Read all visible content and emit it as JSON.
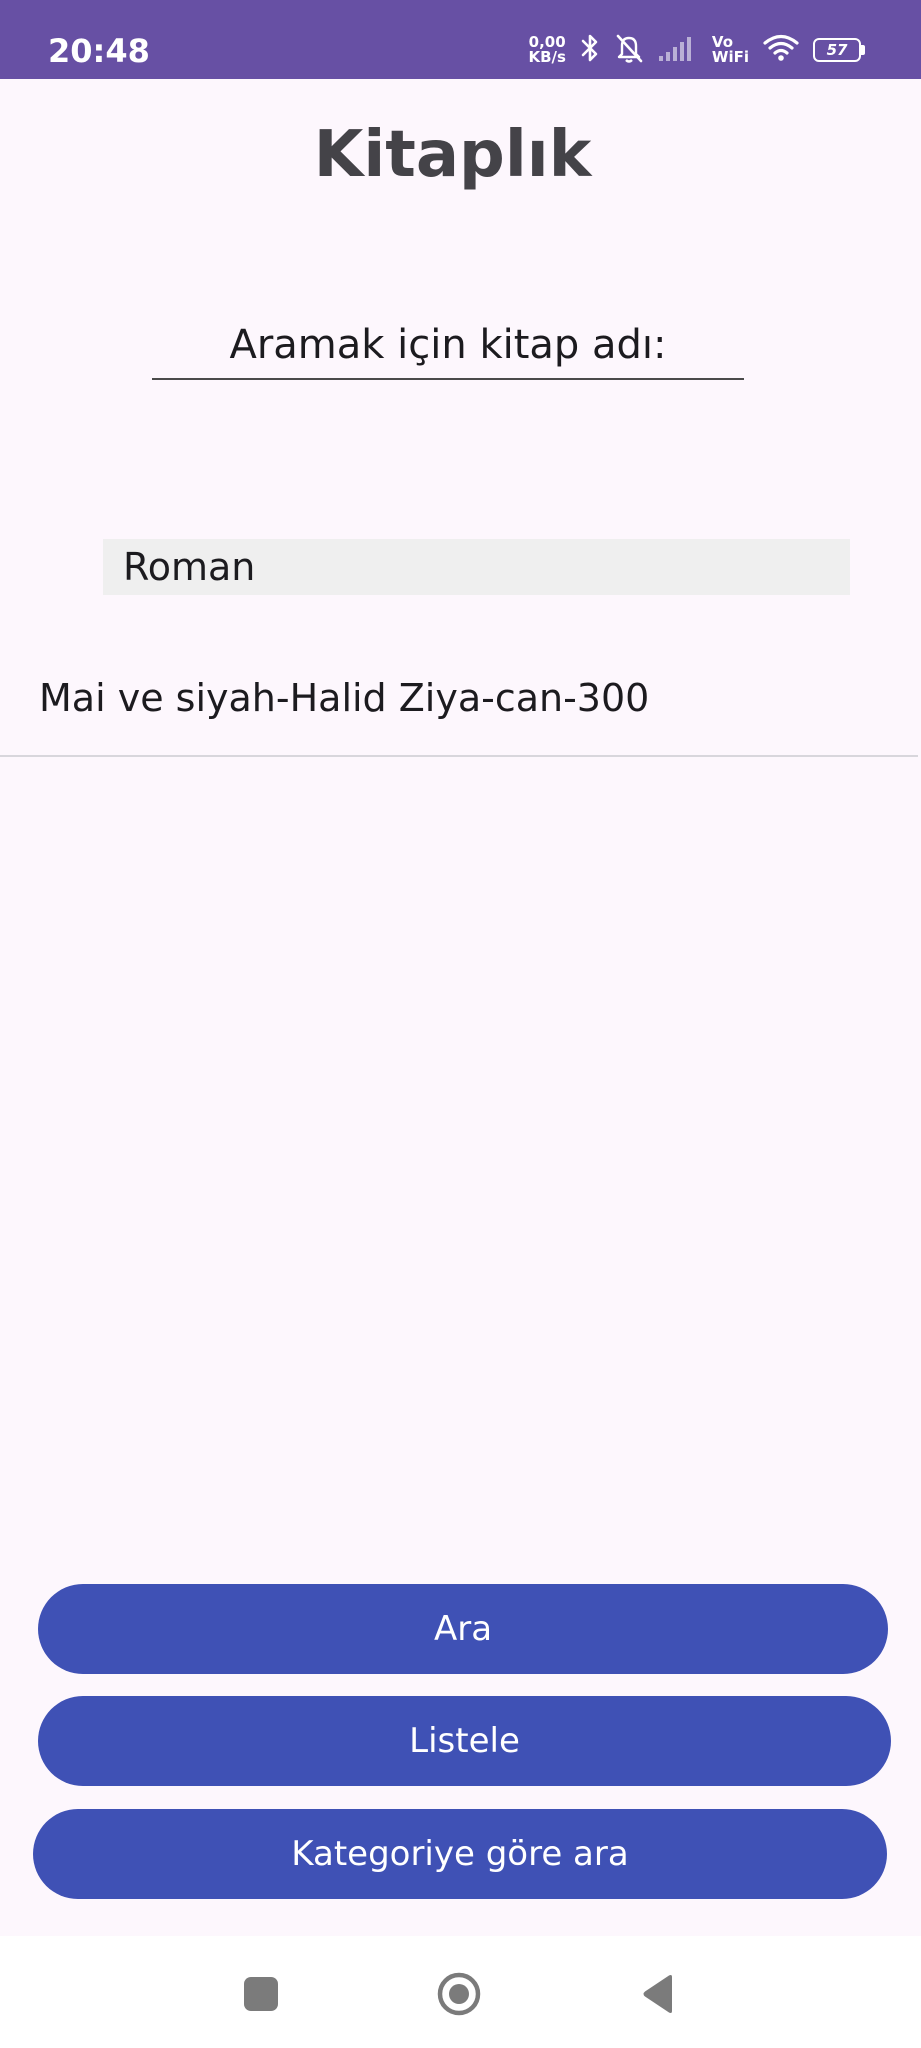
{
  "status_bar": {
    "time": "20:48",
    "net_speed_value": "0,00",
    "net_speed_unit": "KB/s",
    "vowifi_top": "Vo",
    "vowifi_bottom": "WiFi",
    "battery_level": "57",
    "icons": [
      "bluetooth-icon",
      "notifications-off-icon",
      "signal-icon",
      "wifi-icon",
      "battery-icon"
    ]
  },
  "app": {
    "title": "Kitaplık"
  },
  "search": {
    "placeholder": "Aramak için kitap adı:"
  },
  "category": {
    "selected": "Roman"
  },
  "results": [
    {
      "text": "Mai ve siyah-Halid Ziya-can-300"
    }
  ],
  "buttons": {
    "search_label": "Ara",
    "list_label": "Listele",
    "category_search_label": "Kategoriye göre ara"
  },
  "colors": {
    "status_bar": "#6750a4",
    "background": "#fdf7fd",
    "button": "#3f51b5",
    "select_bg": "#efefef"
  },
  "nav": {
    "icons": [
      "recents-icon",
      "home-icon",
      "back-icon"
    ]
  }
}
